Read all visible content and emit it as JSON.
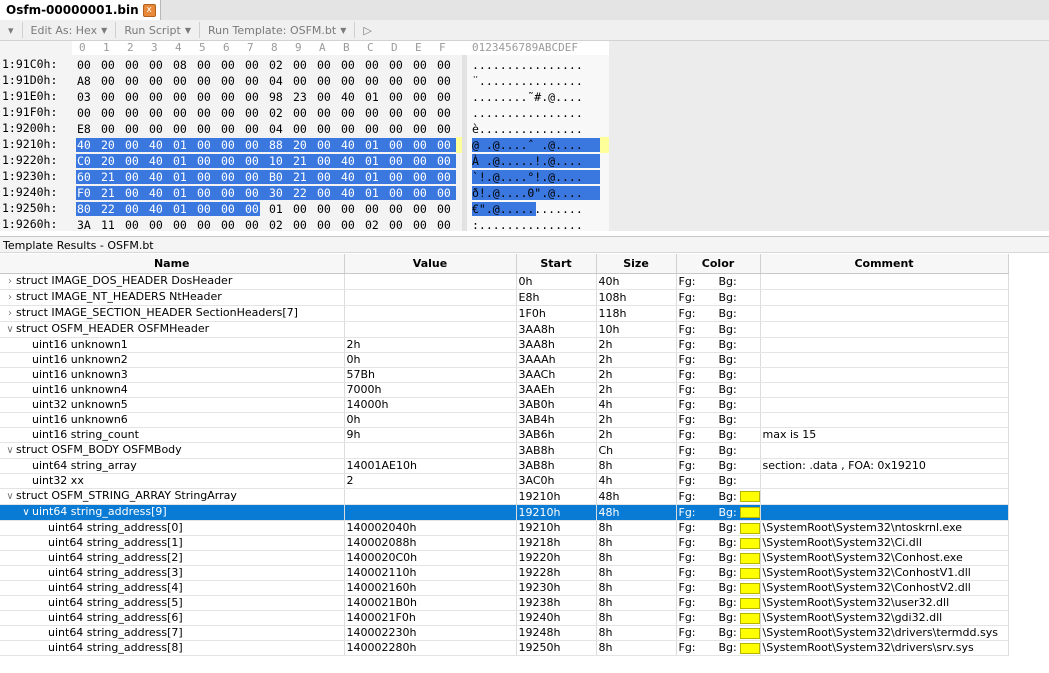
{
  "tab": {
    "title": "Osfm-00000001.bin",
    "close_glyph": "x"
  },
  "toolbar": {
    "edit_as": "Edit As: Hex",
    "run_script": "Run Script",
    "run_template": "Run Template: OSFM.bt"
  },
  "hex": {
    "column_header": [
      "0",
      "1",
      "2",
      "3",
      "4",
      "5",
      "6",
      "7",
      "8",
      "9",
      "A",
      "B",
      "C",
      "D",
      "E",
      "F"
    ],
    "ascii_header": "0123456789ABCDEF",
    "rows": [
      {
        "addr": "1:91C0h:",
        "bytes": [
          "00",
          "00",
          "00",
          "00",
          "08",
          "00",
          "00",
          "00",
          "02",
          "00",
          "00",
          "00",
          "00",
          "00",
          "00",
          "00"
        ],
        "ascii": "................",
        "sel": [
          0,
          0
        ]
      },
      {
        "addr": "1:91D0h:",
        "bytes": [
          "A8",
          "00",
          "00",
          "00",
          "00",
          "00",
          "00",
          "00",
          "04",
          "00",
          "00",
          "00",
          "00",
          "00",
          "00",
          "00"
        ],
        "ascii": "¨...............",
        "sel": [
          0,
          0
        ]
      },
      {
        "addr": "1:91E0h:",
        "bytes": [
          "03",
          "00",
          "00",
          "00",
          "00",
          "00",
          "00",
          "00",
          "98",
          "23",
          "00",
          "40",
          "01",
          "00",
          "00",
          "00"
        ],
        "ascii": "........˜#.@....",
        "sel": [
          0,
          0
        ]
      },
      {
        "addr": "1:91F0h:",
        "bytes": [
          "00",
          "00",
          "00",
          "00",
          "00",
          "00",
          "00",
          "00",
          "02",
          "00",
          "00",
          "00",
          "00",
          "00",
          "00",
          "00"
        ],
        "ascii": "................",
        "sel": [
          0,
          0
        ]
      },
      {
        "addr": "1:9200h:",
        "bytes": [
          "E8",
          "00",
          "00",
          "00",
          "00",
          "00",
          "00",
          "00",
          "04",
          "00",
          "00",
          "00",
          "00",
          "00",
          "00",
          "00"
        ],
        "ascii": "è...............",
        "sel": [
          0,
          0
        ]
      },
      {
        "addr": "1:9210h:",
        "bytes": [
          "40",
          "20",
          "00",
          "40",
          "01",
          "00",
          "00",
          "00",
          "88",
          "20",
          "00",
          "40",
          "01",
          "00",
          "00",
          "00"
        ],
        "ascii": "@ .@....ˆ .@....",
        "sel": [
          0,
          16
        ]
      },
      {
        "addr": "1:9220h:",
        "bytes": [
          "C0",
          "20",
          "00",
          "40",
          "01",
          "00",
          "00",
          "00",
          "10",
          "21",
          "00",
          "40",
          "01",
          "00",
          "00",
          "00"
        ],
        "ascii": "À .@.....!.@....",
        "sel": [
          0,
          16
        ]
      },
      {
        "addr": "1:9230h:",
        "bytes": [
          "60",
          "21",
          "00",
          "40",
          "01",
          "00",
          "00",
          "00",
          "B0",
          "21",
          "00",
          "40",
          "01",
          "00",
          "00",
          "00"
        ],
        "ascii": "`!.@....°!.@....",
        "sel": [
          0,
          16
        ]
      },
      {
        "addr": "1:9240h:",
        "bytes": [
          "F0",
          "21",
          "00",
          "40",
          "01",
          "00",
          "00",
          "00",
          "30",
          "22",
          "00",
          "40",
          "01",
          "00",
          "00",
          "00"
        ],
        "ascii": "ð!.@....0\".@....",
        "sel": [
          0,
          16
        ]
      },
      {
        "addr": "1:9250h:",
        "bytes": [
          "80",
          "22",
          "00",
          "40",
          "01",
          "00",
          "00",
          "00",
          "01",
          "00",
          "00",
          "00",
          "00",
          "00",
          "00",
          "00"
        ],
        "ascii": "€\".@............",
        "sel": [
          0,
          8
        ]
      },
      {
        "addr": "1:9260h:",
        "bytes": [
          "3A",
          "11",
          "00",
          "00",
          "00",
          "00",
          "00",
          "00",
          "02",
          "00",
          "00",
          "00",
          "02",
          "00",
          "00",
          "00"
        ],
        "ascii": ":...............",
        "sel": [
          0,
          0
        ]
      }
    ]
  },
  "template_label": "Template Results - OSFM.bt",
  "grid": {
    "headers": [
      "Name",
      "Value",
      "Start",
      "Size",
      "Color",
      "Comment"
    ],
    "rows": [
      {
        "indent": 0,
        "toggle": ">",
        "name": "struct IMAGE_DOS_HEADER DosHeader",
        "value": "",
        "start": "0h",
        "size": "40h",
        "fg": "Fg:",
        "bg": "Bg:",
        "swatch": false,
        "comment": ""
      },
      {
        "indent": 0,
        "toggle": ">",
        "name": "struct IMAGE_NT_HEADERS NtHeader",
        "value": "",
        "start": "E8h",
        "size": "108h",
        "fg": "Fg:",
        "bg": "Bg:",
        "swatch": false,
        "comment": ""
      },
      {
        "indent": 0,
        "toggle": ">",
        "name": "struct IMAGE_SECTION_HEADER SectionHeaders[7]",
        "value": "",
        "start": "1F0h",
        "size": "118h",
        "fg": "Fg:",
        "bg": "Bg:",
        "swatch": false,
        "comment": ""
      },
      {
        "indent": 0,
        "toggle": "v",
        "name": "struct OSFM_HEADER OSFMHeader",
        "value": "",
        "start": "3AA8h",
        "size": "10h",
        "fg": "Fg:",
        "bg": "Bg:",
        "swatch": false,
        "comment": ""
      },
      {
        "indent": 1,
        "toggle": "",
        "name": "uint16 unknown1",
        "value": "2h",
        "start": "3AA8h",
        "size": "2h",
        "fg": "Fg:",
        "bg": "Bg:",
        "swatch": false,
        "comment": ""
      },
      {
        "indent": 1,
        "toggle": "",
        "name": "uint16 unknown2",
        "value": "0h",
        "start": "3AAAh",
        "size": "2h",
        "fg": "Fg:",
        "bg": "Bg:",
        "swatch": false,
        "comment": ""
      },
      {
        "indent": 1,
        "toggle": "",
        "name": "uint16 unknown3",
        "value": "57Bh",
        "start": "3AACh",
        "size": "2h",
        "fg": "Fg:",
        "bg": "Bg:",
        "swatch": false,
        "comment": ""
      },
      {
        "indent": 1,
        "toggle": "",
        "name": "uint16 unknown4",
        "value": "7000h",
        "start": "3AAEh",
        "size": "2h",
        "fg": "Fg:",
        "bg": "Bg:",
        "swatch": false,
        "comment": ""
      },
      {
        "indent": 1,
        "toggle": "",
        "name": "uint32 unknown5",
        "value": "14000h",
        "start": "3AB0h",
        "size": "4h",
        "fg": "Fg:",
        "bg": "Bg:",
        "swatch": false,
        "comment": ""
      },
      {
        "indent": 1,
        "toggle": "",
        "name": "uint16 unknown6",
        "value": "0h",
        "start": "3AB4h",
        "size": "2h",
        "fg": "Fg:",
        "bg": "Bg:",
        "swatch": false,
        "comment": ""
      },
      {
        "indent": 1,
        "toggle": "",
        "name": "uint16 string_count",
        "value": "9h",
        "start": "3AB6h",
        "size": "2h",
        "fg": "Fg:",
        "bg": "Bg:",
        "swatch": false,
        "comment": "max is 15"
      },
      {
        "indent": 0,
        "toggle": "v",
        "name": "struct OSFM_BODY OSFMBody",
        "value": "",
        "start": "3AB8h",
        "size": "Ch",
        "fg": "Fg:",
        "bg": "Bg:",
        "swatch": false,
        "comment": ""
      },
      {
        "indent": 1,
        "toggle": "",
        "name": "uint64 string_array",
        "value": "14001AE10h",
        "start": "3AB8h",
        "size": "8h",
        "fg": "Fg:",
        "bg": "Bg:",
        "swatch": false,
        "comment": "section: .data , FOA: 0x19210"
      },
      {
        "indent": 1,
        "toggle": "",
        "name": "uint32 xx",
        "value": "2",
        "start": "3AC0h",
        "size": "4h",
        "fg": "Fg:",
        "bg": "Bg:",
        "swatch": false,
        "comment": ""
      },
      {
        "indent": 0,
        "toggle": "v",
        "name": "struct OSFM_STRING_ARRAY StringArray",
        "value": "",
        "start": "19210h",
        "size": "48h",
        "fg": "Fg:",
        "bg": "Bg:",
        "swatch": true,
        "comment": ""
      },
      {
        "indent": 1,
        "toggle": "v",
        "name": "uint64 string_address[9]",
        "value": "",
        "start": "19210h",
        "size": "48h",
        "fg": "Fg:",
        "bg": "Bg:",
        "swatch": true,
        "comment": "",
        "selected": true
      },
      {
        "indent": 2,
        "toggle": "",
        "name": "uint64 string_address[0]",
        "value": "140002040h",
        "start": "19210h",
        "size": "8h",
        "fg": "Fg:",
        "bg": "Bg:",
        "swatch": true,
        "comment": "\\SystemRoot\\System32\\ntoskrnl.exe"
      },
      {
        "indent": 2,
        "toggle": "",
        "name": "uint64 string_address[1]",
        "value": "140002088h",
        "start": "19218h",
        "size": "8h",
        "fg": "Fg:",
        "bg": "Bg:",
        "swatch": true,
        "comment": "\\SystemRoot\\System32\\Ci.dll"
      },
      {
        "indent": 2,
        "toggle": "",
        "name": "uint64 string_address[2]",
        "value": "1400020C0h",
        "start": "19220h",
        "size": "8h",
        "fg": "Fg:",
        "bg": "Bg:",
        "swatch": true,
        "comment": "\\SystemRoot\\System32\\Conhost.exe"
      },
      {
        "indent": 2,
        "toggle": "",
        "name": "uint64 string_address[3]",
        "value": "140002110h",
        "start": "19228h",
        "size": "8h",
        "fg": "Fg:",
        "bg": "Bg:",
        "swatch": true,
        "comment": "\\SystemRoot\\System32\\ConhostV1.dll"
      },
      {
        "indent": 2,
        "toggle": "",
        "name": "uint64 string_address[4]",
        "value": "140002160h",
        "start": "19230h",
        "size": "8h",
        "fg": "Fg:",
        "bg": "Bg:",
        "swatch": true,
        "comment": "\\SystemRoot\\System32\\ConhostV2.dll"
      },
      {
        "indent": 2,
        "toggle": "",
        "name": "uint64 string_address[5]",
        "value": "1400021B0h",
        "start": "19238h",
        "size": "8h",
        "fg": "Fg:",
        "bg": "Bg:",
        "swatch": true,
        "comment": "\\SystemRoot\\System32\\user32.dll"
      },
      {
        "indent": 2,
        "toggle": "",
        "name": "uint64 string_address[6]",
        "value": "1400021F0h",
        "start": "19240h",
        "size": "8h",
        "fg": "Fg:",
        "bg": "Bg:",
        "swatch": true,
        "comment": "\\SystemRoot\\System32\\gdi32.dll"
      },
      {
        "indent": 2,
        "toggle": "",
        "name": "uint64 string_address[7]",
        "value": "140002230h",
        "start": "19248h",
        "size": "8h",
        "fg": "Fg:",
        "bg": "Bg:",
        "swatch": true,
        "comment": "\\SystemRoot\\System32\\drivers\\termdd.sys"
      },
      {
        "indent": 2,
        "toggle": "",
        "name": "uint64 string_address[8]",
        "value": "140002280h",
        "start": "19250h",
        "size": "8h",
        "fg": "Fg:",
        "bg": "Bg:",
        "swatch": true,
        "comment": "\\SystemRoot\\System32\\drivers\\srv.sys"
      }
    ]
  },
  "colors": {
    "selection": "#3a78e0",
    "selected_row": "#0a7bd4",
    "swatch": "#ffff00"
  }
}
